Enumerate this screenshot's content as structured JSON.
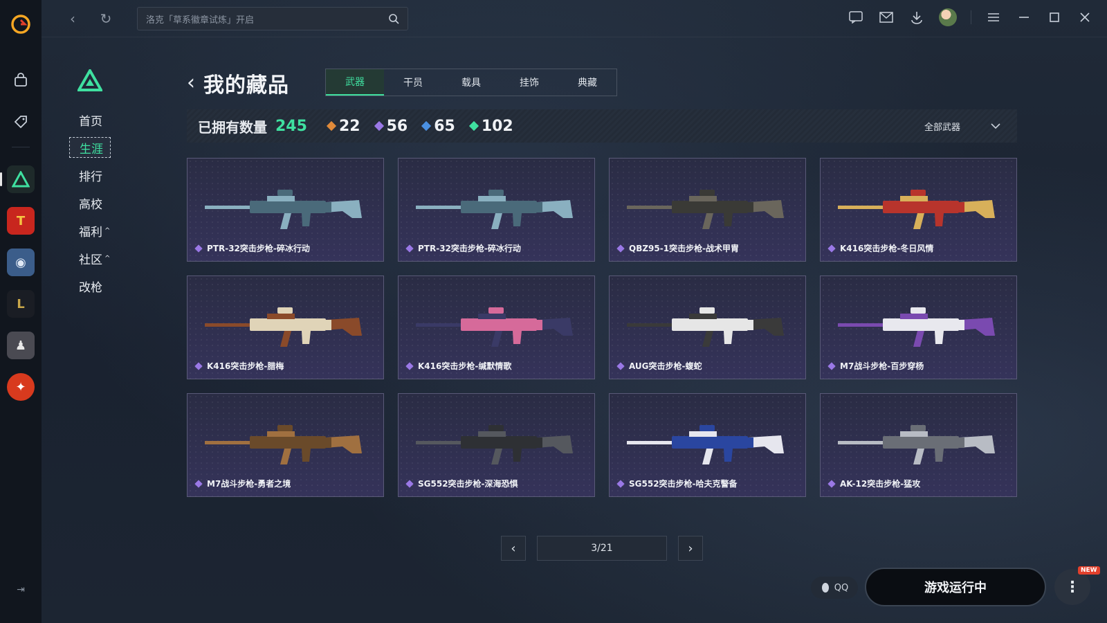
{
  "topbar": {
    "search_placeholder": "洛克「草系徽章试炼」开启"
  },
  "subnav": {
    "items": [
      {
        "label": "首页",
        "active": false,
        "caret": ""
      },
      {
        "label": "生涯",
        "active": true,
        "caret": ""
      },
      {
        "label": "排行",
        "active": false,
        "caret": ""
      },
      {
        "label": "高校",
        "active": false,
        "caret": ""
      },
      {
        "label": "福利",
        "active": false,
        "caret": "^"
      },
      {
        "label": "社区",
        "active": false,
        "caret": "^"
      },
      {
        "label": "改枪",
        "active": false,
        "caret": ""
      }
    ]
  },
  "header": {
    "title": "我的藏品",
    "tabs": [
      "武器",
      "干员",
      "载具",
      "挂饰",
      "典藏"
    ],
    "active_tab": "武器"
  },
  "stats": {
    "owned_label": "已拥有数量",
    "owned_total": "245",
    "counts": [
      {
        "value": "22",
        "color": "#e08a3a"
      },
      {
        "value": "56",
        "color": "#9a78e6"
      },
      {
        "value": "65",
        "color": "#4a90e2"
      },
      {
        "value": "102",
        "color": "#3fe0a0"
      }
    ],
    "filter_label": "全部武器"
  },
  "items": [
    {
      "name": "PTR-32突击步枪-碎冰行动",
      "colors": [
        "#4a6a7a",
        "#8ab0c0"
      ]
    },
    {
      "name": "PTR-32突击步枪-碎冰行动",
      "colors": [
        "#4a6a7a",
        "#8ab0c0"
      ]
    },
    {
      "name": "QBZ95-1突击步枪-战术甲胄",
      "colors": [
        "#3a3a36",
        "#6a665c"
      ]
    },
    {
      "name": "K416突击步枪-冬日风情",
      "colors": [
        "#b8342c",
        "#d8b05a"
      ]
    },
    {
      "name": "K416突击步枪-腊梅",
      "colors": [
        "#e0d4b8",
        "#8a4a2a"
      ]
    },
    {
      "name": "K416突击步枪-缄默情歌",
      "colors": [
        "#d66a9a",
        "#3a3a66"
      ]
    },
    {
      "name": "AUG突击步枪-蝮蛇",
      "colors": [
        "#e6e6e6",
        "#3a3a3a"
      ]
    },
    {
      "name": "M7战斗步枪-百步穿杨",
      "colors": [
        "#e8e8ee",
        "#7a4ab0"
      ]
    },
    {
      "name": "M7战斗步枪-勇者之境",
      "colors": [
        "#6a4a2a",
        "#a07040"
      ]
    },
    {
      "name": "SG552突击步枪-深海恐惧",
      "colors": [
        "#2e3034",
        "#55585e"
      ]
    },
    {
      "name": "SG552突击步枪-哈夫克警备",
      "colors": [
        "#2a46a0",
        "#e6e6ee"
      ]
    },
    {
      "name": "AK-12突击步枪-猛攻",
      "colors": [
        "#6a6e76",
        "#b8bcc4"
      ]
    }
  ],
  "pagination": {
    "label": "3/21"
  },
  "footer": {
    "qq_label": "QQ",
    "run_label": "游戏运行中",
    "new_badge": "NEW"
  }
}
